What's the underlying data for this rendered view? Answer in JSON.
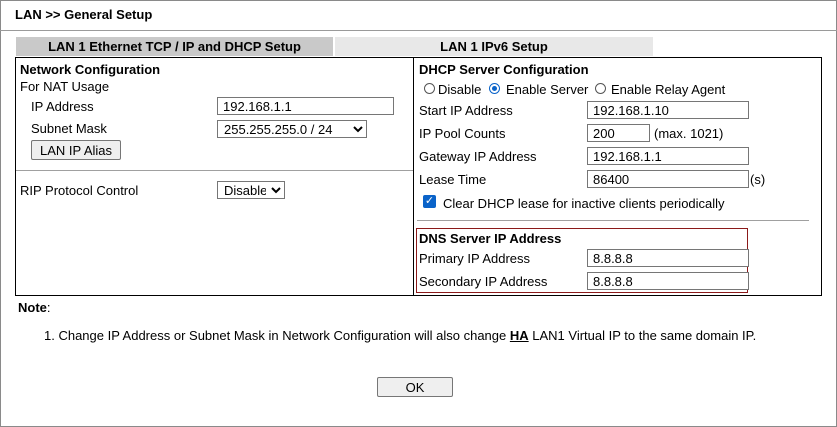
{
  "page": {
    "title": "LAN >> General Setup"
  },
  "tabs": [
    {
      "label": "LAN 1 Ethernet TCP / IP and DHCP Setup",
      "active": true
    },
    {
      "label": "LAN 1 IPv6 Setup",
      "active": false
    }
  ],
  "network": {
    "heading": "Network Configuration",
    "nat_usage": "For NAT Usage",
    "ip_label": "IP Address",
    "ip_value": "192.168.1.1",
    "subnet_label": "Subnet Mask",
    "subnet_value": "255.255.255.0 / 24",
    "alias_button": "LAN IP Alias",
    "rip_label": "RIP Protocol Control",
    "rip_value": "Disable"
  },
  "dhcp": {
    "heading": "DHCP Server Configuration",
    "mode_options": [
      "Disable",
      "Enable Server",
      "Enable Relay Agent"
    ],
    "mode_selected": "Enable Server",
    "start_ip_label": "Start IP Address",
    "start_ip_value": "192.168.1.10",
    "pool_label": "IP Pool Counts",
    "pool_value": "200",
    "pool_max": "(max. 1021)",
    "gateway_label": "Gateway IP Address",
    "gateway_value": "192.168.1.1",
    "lease_label": "Lease Time",
    "lease_value": "86400",
    "lease_unit": "(s)",
    "clear_lease_label": "Clear DHCP lease for inactive clients periodically",
    "clear_lease_checked": true
  },
  "dns": {
    "heading": "DNS Server IP Address",
    "primary_label": "Primary IP Address",
    "primary_value": "8.8.8.8",
    "secondary_label": "Secondary IP Address",
    "secondary_value": "8.8.8.8"
  },
  "note": {
    "label": "Note",
    "colon": ":",
    "item_prefix": "1. Change IP Address or Subnet Mask in Network Configuration will also change ",
    "item_link": "HA",
    "item_suffix": " LAN1 Virtual IP to the same domain IP."
  },
  "ok_button": "OK",
  "colors": {
    "accent": "#0a63c9",
    "dns_border": "#8b1a1a",
    "active_tab": "#c9c9c9",
    "inactive_tab": "#e8e8e8"
  }
}
